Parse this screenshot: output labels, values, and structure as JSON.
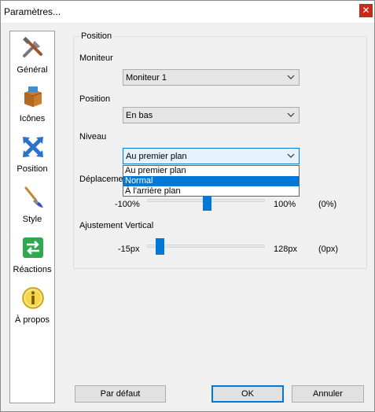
{
  "window": {
    "title": "Paramètres..."
  },
  "sidebar": {
    "items": [
      {
        "label": "Général",
        "icon": "tools-icon"
      },
      {
        "label": "Icônes",
        "icon": "box-icon"
      },
      {
        "label": "Position",
        "icon": "arrows-move-icon",
        "selected": true
      },
      {
        "label": "Style",
        "icon": "brush-icon"
      },
      {
        "label": "Réactions",
        "icon": "arrows-exchange-icon"
      },
      {
        "label": "À propos",
        "icon": "info-icon"
      }
    ]
  },
  "group": {
    "legend": "Position"
  },
  "moniteur": {
    "label": "Moniteur",
    "value": "Moniteur 1"
  },
  "position": {
    "label": "Position",
    "value": "En bas"
  },
  "niveau": {
    "label": "Niveau",
    "value": "Au premier plan",
    "options": [
      "Au premier plan",
      "Normal",
      "À l'arrière plan"
    ],
    "highlighted_index": 1
  },
  "deplacement": {
    "label": "Déplacemen",
    "min_label": "-100%",
    "max_label": "100%",
    "value_text": "(0%)",
    "value_fraction": 0.5
  },
  "ajustement": {
    "label": "Ajustement Vertical",
    "min_label": "-15px",
    "max_label": "128px",
    "value_text": "(0px)",
    "value_fraction": 0.105
  },
  "buttons": {
    "default": "Par défaut",
    "ok": "OK",
    "cancel": "Annuler"
  },
  "colors": {
    "accent": "#0078d7",
    "close": "#c42b1c"
  }
}
